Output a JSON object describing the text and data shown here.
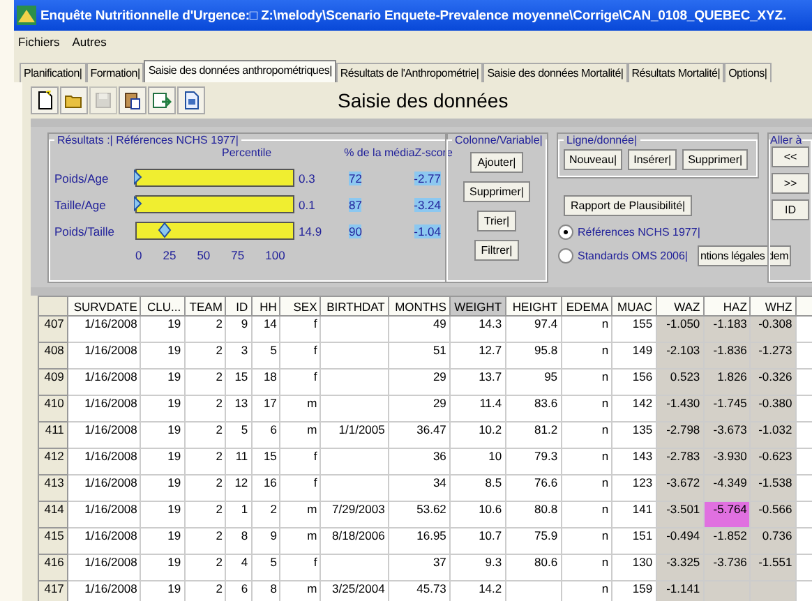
{
  "window": {
    "title": "Enquête Nutritionnelle d'Urgence:□ Z:\\melody\\Scenario Enquete-Prevalence moyenne\\Corrige\\CAN_0108_QUEBEC_XYZ."
  },
  "menu": [
    "Fichiers",
    "Autres"
  ],
  "tabs": [
    {
      "label": "Planification|",
      "selected": false
    },
    {
      "label": "Formation|",
      "selected": false
    },
    {
      "label": "Saisie des données anthropométriques|",
      "selected": true
    },
    {
      "label": "Résultats de l'Anthropométrie|",
      "selected": false
    },
    {
      "label": "Saisie des données Mortalité|",
      "selected": false
    },
    {
      "label": "Résultats Mortalité|",
      "selected": false
    },
    {
      "label": "Options|",
      "selected": false
    }
  ],
  "toolbar": [
    {
      "kind": "new",
      "disabled": false
    },
    {
      "kind": "open",
      "disabled": false
    },
    {
      "kind": "save",
      "disabled": true
    },
    {
      "kind": "paste",
      "disabled": false
    },
    {
      "kind": "export",
      "disabled": false
    },
    {
      "kind": "document",
      "disabled": false
    }
  ],
  "heading": "Saisie des données",
  "results": {
    "title": "Résultats :| Références NCHS 1977|",
    "percentile_label": "Percentile",
    "pct_median_label": "% de la média",
    "zscore_label": "Z-score",
    "rows": [
      {
        "label": "Poids/Age",
        "level": 0.003,
        "percentile": "0.3",
        "pct_median": "72",
        "zscore": "-2.77"
      },
      {
        "label": "Taille/Age",
        "level": 0.001,
        "percentile": "0.1",
        "pct_median": "87",
        "zscore": "-3.24"
      },
      {
        "label": "Poids/Taille",
        "level": 0.149,
        "percentile": "14.9",
        "pct_median": "90",
        "zscore": "-1.04"
      }
    ],
    "scale": [
      "0",
      "25",
      "50",
      "75",
      "100"
    ]
  },
  "column_group": {
    "title": "Colonne/Variable|",
    "buttons": [
      "Ajouter|",
      "Supprimer|",
      "Trier|",
      "Filtrer|"
    ]
  },
  "row_group": {
    "title": "Ligne/donnée|",
    "buttons": [
      "Nouveau|",
      "Insérer|",
      "Supprimer|"
    ]
  },
  "plausibility_button": "Rapport de Plausibilité|",
  "references": [
    {
      "label": "Références NCHS 1977|",
      "selected": true
    },
    {
      "label": "Standards OMS 2006|",
      "selected": false
    }
  ],
  "legal_button": "ntions légales dem",
  "goto_group": {
    "title": "Aller à",
    "buttons": [
      "<<",
      ">>",
      "ID"
    ]
  },
  "table": {
    "columns": [
      {
        "label": "SURVDATE",
        "kind": "data",
        "selected": false
      },
      {
        "label": "CLU...",
        "kind": "data",
        "selected": false
      },
      {
        "label": "TEAM",
        "kind": "data",
        "selected": false
      },
      {
        "label": "ID",
        "kind": "data",
        "selected": false
      },
      {
        "label": "HH",
        "kind": "data",
        "selected": false
      },
      {
        "label": "SEX",
        "kind": "data",
        "selected": false
      },
      {
        "label": "BIRTHDAT",
        "kind": "data",
        "selected": false
      },
      {
        "label": "MONTHS",
        "kind": "data",
        "selected": false
      },
      {
        "label": "WEIGHT",
        "kind": "data",
        "selected": true
      },
      {
        "label": "HEIGHT",
        "kind": "data",
        "selected": false
      },
      {
        "label": "EDEMA",
        "kind": "data",
        "selected": false
      },
      {
        "label": "MUAC",
        "kind": "data",
        "selected": false
      },
      {
        "label": "WAZ",
        "kind": "computed",
        "selected": false
      },
      {
        "label": "HAZ",
        "kind": "computed",
        "selected": false
      },
      {
        "label": "WHZ",
        "kind": "computed",
        "selected": false
      }
    ],
    "rows": [
      {
        "number": "407",
        "cells": [
          "1/16/2008",
          "19",
          "2",
          "9",
          "14",
          "f",
          null,
          "49",
          "14.3",
          "97.4",
          "n",
          "155",
          "-1.050",
          "-1.183",
          "-0.308"
        ],
        "z_alerts": [
          false,
          false,
          false
        ]
      },
      {
        "number": "408",
        "cells": [
          "1/16/2008",
          "19",
          "2",
          "3",
          "5",
          "f",
          null,
          "51",
          "12.7",
          "95.8",
          "n",
          "149",
          "-2.103",
          "-1.836",
          "-1.273"
        ],
        "z_alerts": [
          false,
          false,
          false
        ]
      },
      {
        "number": "409",
        "cells": [
          "1/16/2008",
          "19",
          "2",
          "15",
          "18",
          "f",
          null,
          "29",
          "13.7",
          "95",
          "n",
          "156",
          "0.523",
          "1.826",
          "-0.326"
        ],
        "z_alerts": [
          false,
          false,
          false
        ]
      },
      {
        "number": "410",
        "cells": [
          "1/16/2008",
          "19",
          "2",
          "13",
          "17",
          "m",
          null,
          "29",
          "11.4",
          "83.6",
          "n",
          "142",
          "-1.430",
          "-1.745",
          "-0.380"
        ],
        "z_alerts": [
          false,
          false,
          false
        ]
      },
      {
        "number": "411",
        "cells": [
          "1/16/2008",
          "19",
          "2",
          "5",
          "6",
          "m",
          "1/1/2005",
          "36.47",
          "10.2",
          "81.2",
          "n",
          "135",
          "-2.798",
          "-3.673",
          "-1.032"
        ],
        "z_alerts": [
          false,
          false,
          false
        ]
      },
      {
        "number": "412",
        "cells": [
          "1/16/2008",
          "19",
          "2",
          "11",
          "15",
          "f",
          null,
          "36",
          "10",
          "79.3",
          "n",
          "143",
          "-2.783",
          "-3.930",
          "-0.623"
        ],
        "z_alerts": [
          false,
          false,
          false
        ]
      },
      {
        "number": "413",
        "cells": [
          "1/16/2008",
          "19",
          "2",
          "12",
          "16",
          "f",
          null,
          "34",
          "8.5",
          "76.6",
          "n",
          "123",
          "-3.672",
          "-4.349",
          "-1.538"
        ],
        "z_alerts": [
          false,
          false,
          false
        ]
      },
      {
        "number": "414",
        "cells": [
          "1/16/2008",
          "19",
          "2",
          "1",
          "2",
          "m",
          "7/29/2003",
          "53.62",
          "10.6",
          "80.8",
          "n",
          "141",
          "-3.501",
          "-5.764",
          "-0.566"
        ],
        "z_alerts": [
          false,
          true,
          false
        ]
      },
      {
        "number": "415",
        "cells": [
          "1/16/2008",
          "19",
          "2",
          "8",
          "9",
          "m",
          "8/18/2006",
          "16.95",
          "10.7",
          "75.9",
          "n",
          "151",
          "-0.494",
          "-1.852",
          "0.736"
        ],
        "z_alerts": [
          false,
          false,
          false
        ]
      },
      {
        "number": "416",
        "cells": [
          "1/16/2008",
          "19",
          "2",
          "4",
          "5",
          "f",
          null,
          "37",
          "9.3",
          "80.6",
          "n",
          "130",
          "-3.325",
          "-3.736",
          "-1.551"
        ],
        "z_alerts": [
          false,
          false,
          false
        ]
      },
      {
        "number": "417",
        "cells": [
          "1/16/2008",
          "19",
          "2",
          "6",
          "8",
          "m",
          "3/25/2004",
          "45.73",
          "14.2",
          null,
          "n",
          "159",
          "-1.141",
          null,
          null
        ],
        "z_alerts": [
          false,
          false,
          false
        ]
      }
    ]
  }
}
